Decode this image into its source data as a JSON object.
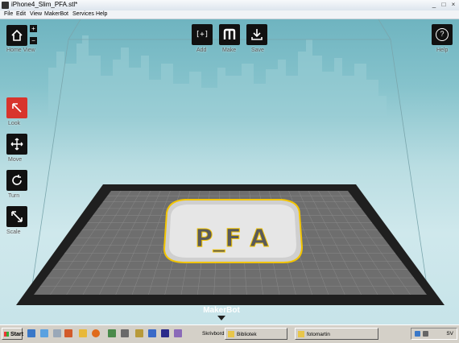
{
  "window": {
    "title": "iPhone4_Slim_PFA.stl*",
    "controls": [
      "_",
      "□",
      "×"
    ]
  },
  "menu": [
    "File",
    "Edit",
    "View",
    "MakerBot",
    "Services",
    "Help"
  ],
  "toolbar": {
    "home_view": "Home View",
    "zoom_in": "+",
    "zoom_out": "−",
    "add": "Add",
    "add_icon_text": "[+]",
    "make": "Make",
    "save": "Save",
    "help": "Help",
    "help_icon_text": "?"
  },
  "tools": {
    "look": "Look",
    "move": "Move",
    "turn": "Turn",
    "scale": "Scale"
  },
  "scene": {
    "brand": "MakerBot",
    "model_text": "P_F A"
  },
  "taskbar": {
    "start": "Start",
    "items": [
      "Skrivbord",
      "Bibliotek",
      "fotomartin"
    ],
    "language": "SV"
  },
  "colors": {
    "sky": "#86c3cc",
    "platform_border": "#1f1f1f",
    "platform_grid": "#6e6e6e",
    "model_fill": "#d9d9d9",
    "model_outline": "#f2c400",
    "active_tool": "#d8342c"
  }
}
